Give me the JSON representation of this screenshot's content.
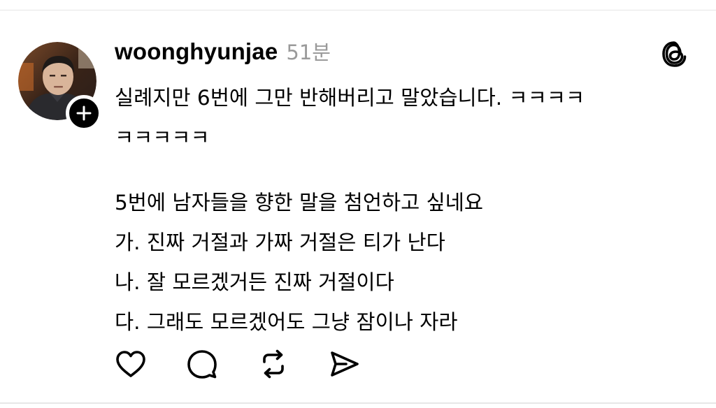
{
  "post": {
    "author": "woonghyunjae",
    "time_ago": "51분",
    "lines": [
      "실례지만 6번에 그만 반해버리고 말았습니다. ㅋㅋㅋㅋ",
      "ㅋㅋㅋㅋㅋ",
      "",
      "5번에 남자들을 향한 말을 첨언하고 싶네요",
      "가. 진짜 거절과 가짜 거절은 티가 난다",
      "나. 잘 모르겠거든 진짜 거절이다",
      "다. 그래도 모르겠어도 그냥 잠이나 자라"
    ]
  },
  "icons": {
    "avatar": "profile-photo",
    "follow": "plus-icon",
    "app_logo": "threads-logo-icon",
    "like": "heart-icon",
    "reply": "comment-icon",
    "repost": "repost-icon",
    "share": "send-icon"
  },
  "colors": {
    "text": "#000000",
    "muted": "#9a9a9a",
    "icon": "#000000",
    "divider": "#e6e6e6"
  }
}
